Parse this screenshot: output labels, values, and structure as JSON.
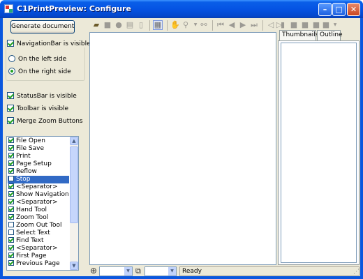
{
  "window": {
    "title": "C1PrintPreview: Configure",
    "buttons": {
      "minimize": "–",
      "maximize": "□",
      "close": "✕"
    }
  },
  "left_panel": {
    "generate_button": "Generate document",
    "navigation_group": {
      "label": "NavigationBar is visible",
      "checked": true,
      "options": [
        {
          "label": "On the left side",
          "selected": false
        },
        {
          "label": "On the right side",
          "selected": true
        }
      ]
    },
    "statusbar_visible": {
      "label": "StatusBar is visible",
      "checked": true
    },
    "toolbar_visible": {
      "label": "Toolbar is visible",
      "checked": true
    },
    "merge_zoom": {
      "label": "Merge Zoom Buttons",
      "checked": true
    },
    "toolbar_items": [
      {
        "label": "File Open",
        "checked": true
      },
      {
        "label": "File Save",
        "checked": true
      },
      {
        "label": "Print",
        "checked": true
      },
      {
        "label": "Page Setup",
        "checked": true
      },
      {
        "label": "Reflow",
        "checked": true
      },
      {
        "label": "Stop",
        "checked": false,
        "selected": true
      },
      {
        "label": "<Separator>",
        "checked": true
      },
      {
        "label": "Show Navigation",
        "checked": true
      },
      {
        "label": "<Separator>",
        "checked": true
      },
      {
        "label": "Hand Tool",
        "checked": true
      },
      {
        "label": "Zoom Tool",
        "checked": true
      },
      {
        "label": "Zoom Out Tool",
        "checked": false
      },
      {
        "label": "Select Text",
        "checked": false
      },
      {
        "label": "Find Text",
        "checked": true
      },
      {
        "label": "<Separator>",
        "checked": true
      },
      {
        "label": "First Page",
        "checked": true
      },
      {
        "label": "Previous Page",
        "checked": true
      }
    ]
  },
  "navigation_tabs": [
    {
      "label": "Thumbnails",
      "active": true
    },
    {
      "label": "Outline",
      "active": false
    }
  ],
  "statusbar": {
    "zoom_value": "",
    "page_value": "",
    "status_text": "Ready"
  },
  "colors": {
    "selection": "#316ac5",
    "titlebar": "#0553e3",
    "face": "#ece9d8"
  }
}
